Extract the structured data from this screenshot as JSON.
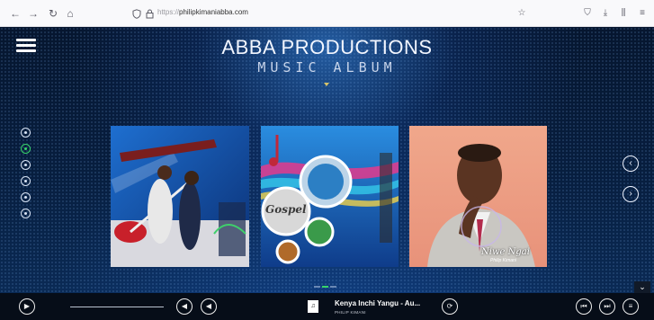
{
  "browser": {
    "url_scheme": "https://",
    "url_host": "philipkimaniabba.com",
    "icons": {
      "back": "arrow-left-icon",
      "forward": "arrow-right-icon",
      "reload": "reload-icon",
      "home": "home-icon",
      "shield": "tracking-shield-icon",
      "lock": "lock-icon",
      "star": "bookmark-star-icon",
      "pocket": "pocket-icon",
      "download": "download-icon",
      "library": "library-icon",
      "menu": "menu-icon"
    }
  },
  "header": {
    "title": "ABBA PRODUCTIONS",
    "subtitle": "MUSIC ALBUM"
  },
  "sidebar": {
    "items": [
      {
        "icon": "home-icon",
        "active": false
      },
      {
        "icon": "music-icon",
        "active": true
      },
      {
        "icon": "user-icon",
        "active": false
      },
      {
        "icon": "chat-icon",
        "active": false
      },
      {
        "icon": "mail-icon",
        "active": false
      },
      {
        "icon": "circle-icon",
        "active": false
      }
    ]
  },
  "carousel": {
    "cards": [
      {
        "image": "artist-duo-guitar-album-art"
      },
      {
        "image": "gospel-music-album-art",
        "text": "Gospel"
      },
      {
        "image": "artist-portrait-album-art",
        "title": "Niwe Ngai",
        "artist": "Philip Kimani"
      }
    ],
    "dots": 3,
    "active_dot": 1
  },
  "player": {
    "track_title": "Kenya Inchi Yangu - Au...",
    "track_artist": "PHILIP KIMANI",
    "track_thumb_icon": "album-thumb-icon"
  },
  "colors": {
    "accent": "#38d36a",
    "background": "#071e3f",
    "player_bg": "#060d18"
  }
}
